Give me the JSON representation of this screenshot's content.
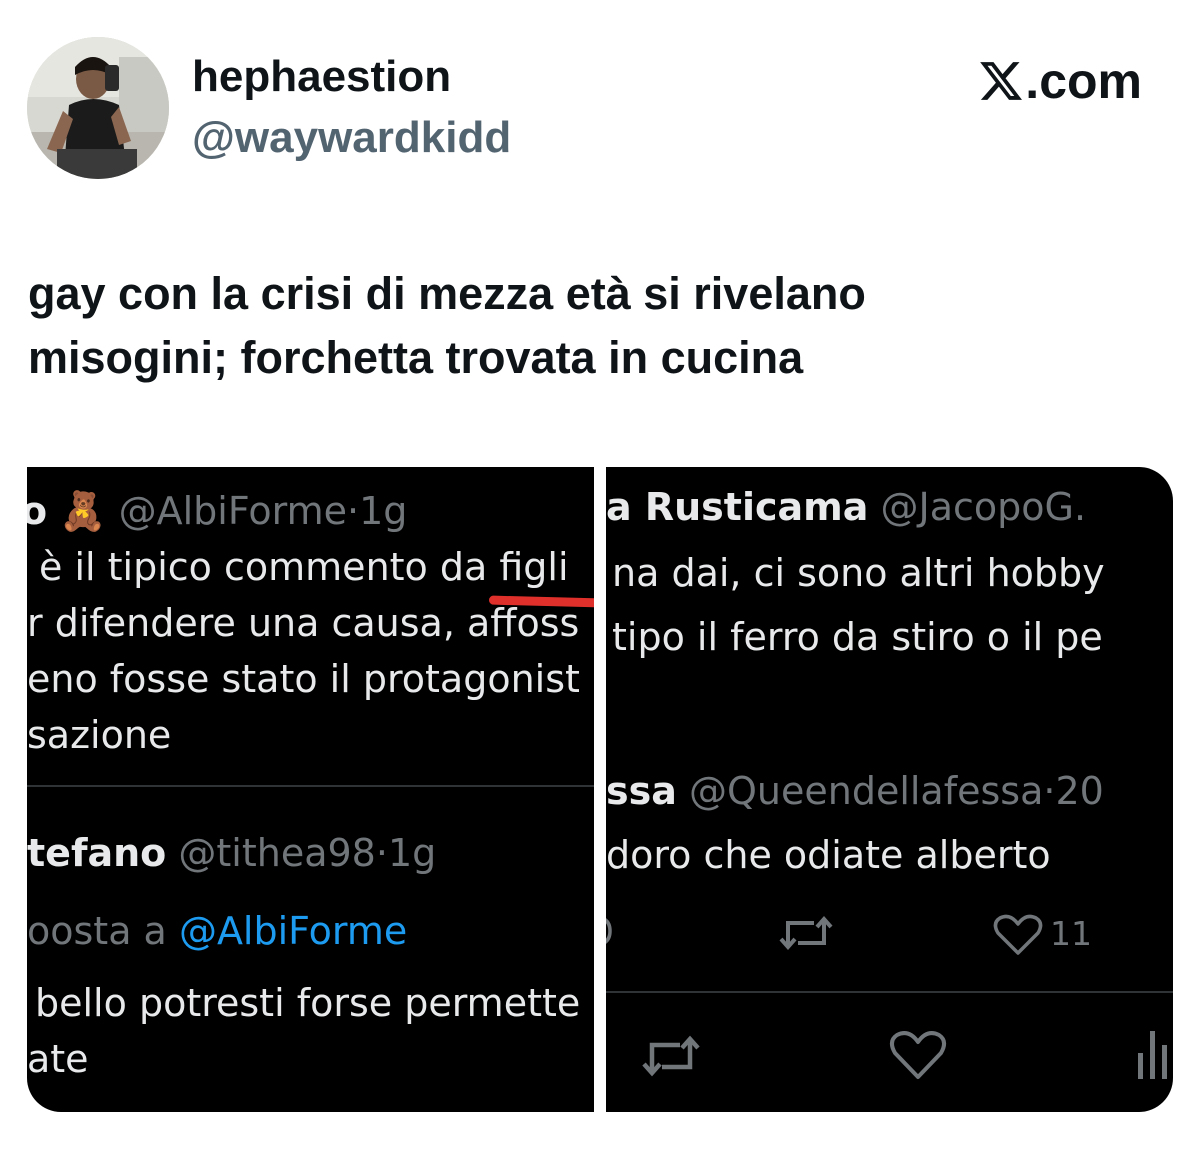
{
  "author": {
    "display_name": "hephaestion",
    "handle": "@waywardkidd"
  },
  "brand": {
    "label": ".com",
    "icon": "x-logo-icon"
  },
  "post": {
    "lines": [
      "gay con la crisi di mezza età si rivelano",
      "misogini; forchetta trovata in cucina"
    ]
  },
  "left_screenshot": {
    "tweet1": {
      "name_fragment": "o",
      "emoji": "🧸",
      "handle": "@AlbiForme",
      "dot": "·",
      "time": "1g",
      "line1_a": "è il tipico commento da ",
      "line1_b": "figli",
      "line2": "r difendere una causa, affoss",
      "line3": "eno fosse stato il protagonist",
      "line4": "sazione"
    },
    "tweet2": {
      "name_fragment": "tefano",
      "handle": "@tithea98",
      "dot": "·",
      "time": "1g",
      "reply_prefix": "oosta a ",
      "reply_mention": "@AlbiForme",
      "line1": "bello potresti forse permette",
      "line2": "ate"
    }
  },
  "right_screenshot": {
    "tweet1": {
      "name_fragment": "a Rusticama",
      "handle": "@JacopoG.",
      "line1": "na dai, ci sono altri hobby",
      "line2": "tipo il ferro da stiro o il pe"
    },
    "tweet2": {
      "name_fragment": "ssa",
      "handle": "@Queendellafessa",
      "dot": "·",
      "time": "20",
      "line1": "doro che odiate alberto",
      "like_count": "11"
    }
  },
  "colors": {
    "text_primary": "#0f1419",
    "text_secondary": "#536471",
    "dark_bg": "#000000",
    "dark_text": "#e7e9ea",
    "dark_meta": "#71767b",
    "mention": "#1d9bf0",
    "annotation": "#e0302b"
  }
}
